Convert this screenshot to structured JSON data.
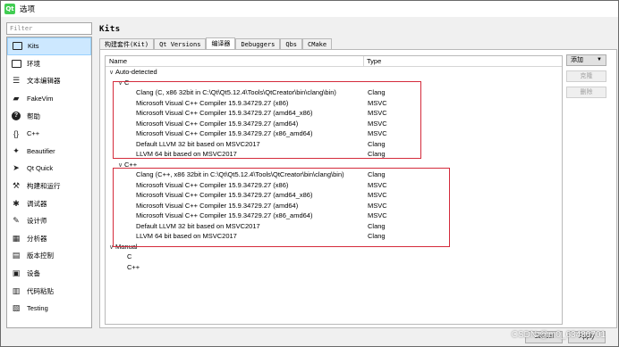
{
  "window": {
    "title": "选项"
  },
  "filter": {
    "placeholder": "Filter"
  },
  "sidebar": {
    "items": [
      {
        "label": "Kits",
        "icon": "computer-icon"
      },
      {
        "label": "环境",
        "icon": "monitor-icon"
      },
      {
        "label": "文本编辑器",
        "icon": "text-editor-icon"
      },
      {
        "label": "FakeVim",
        "icon": "fakevim-icon"
      },
      {
        "label": "帮助",
        "icon": "help-icon"
      },
      {
        "label": "C++",
        "icon": "braces-icon"
      },
      {
        "label": "Beautifier",
        "icon": "sparkle-icon"
      },
      {
        "label": "Qt Quick",
        "icon": "qtquick-icon"
      },
      {
        "label": "构建和运行",
        "icon": "hammer-icon"
      },
      {
        "label": "调试器",
        "icon": "debugger-icon"
      },
      {
        "label": "设计师",
        "icon": "pencil-icon"
      },
      {
        "label": "分析器",
        "icon": "analyzer-icon"
      },
      {
        "label": "版本控制",
        "icon": "version-control-icon"
      },
      {
        "label": "设备",
        "icon": "device-icon"
      },
      {
        "label": "代码粘贴",
        "icon": "paste-icon"
      },
      {
        "label": "Testing",
        "icon": "testing-icon"
      }
    ]
  },
  "page": {
    "heading": "Kits"
  },
  "tabs": [
    "构建套件(Kit)",
    "Qt Versions",
    "编译器",
    "Debuggers",
    "Qbs",
    "CMake"
  ],
  "tree": {
    "columns": [
      "Name",
      "Type"
    ],
    "auto_label": "Auto-detected",
    "c_label": "C",
    "c_items": [
      {
        "name": "Clang (C, x86 32bit in C:\\Qt\\Qt5.12.4\\Tools\\QtCreator\\bin\\clang\\bin)",
        "type": "Clang"
      },
      {
        "name": "Microsoft Visual C++ Compiler 15.9.34729.27 (x86)",
        "type": "MSVC"
      },
      {
        "name": "Microsoft Visual C++ Compiler 15.9.34729.27 (amd64_x86)",
        "type": "MSVC"
      },
      {
        "name": "Microsoft Visual C++ Compiler 15.9.34729.27 (amd64)",
        "type": "MSVC"
      },
      {
        "name": "Microsoft Visual C++ Compiler 15.9.34729.27 (x86_amd64)",
        "type": "MSVC"
      },
      {
        "name": "Default LLVM 32 bit based on MSVC2017",
        "type": "Clang"
      },
      {
        "name": "LLVM 64 bit based on MSVC2017",
        "type": "Clang"
      }
    ],
    "cpp_label": "C++",
    "cpp_items": [
      {
        "name": "Clang (C++, x86 32bit in C:\\Qt\\Qt5.12.4\\Tools\\QtCreator\\bin\\clang\\bin)",
        "type": "Clang"
      },
      {
        "name": "Microsoft Visual C++ Compiler 15.9.34729.27 (x86)",
        "type": "MSVC"
      },
      {
        "name": "Microsoft Visual C++ Compiler 15.9.34729.27 (amd64_x86)",
        "type": "MSVC"
      },
      {
        "name": "Microsoft Visual C++ Compiler 15.9.34729.27 (amd64)",
        "type": "MSVC"
      },
      {
        "name": "Microsoft Visual C++ Compiler 15.9.34729.27 (x86_amd64)",
        "type": "MSVC"
      },
      {
        "name": "Default LLVM 32 bit based on MSVC2017",
        "type": "Clang"
      },
      {
        "name": "LLVM 64 bit based on MSVC2017",
        "type": "Clang"
      }
    ],
    "manual_label": "Manual",
    "manual_children": [
      "C",
      "C++"
    ]
  },
  "buttons": {
    "add": "添加",
    "add_arrow": "▼",
    "clone": "克隆",
    "remove": "删除"
  },
  "footer": {
    "cancel": "Cancel",
    "apply": "Apply"
  },
  "watermark": "CSDN @m0_63480701"
}
